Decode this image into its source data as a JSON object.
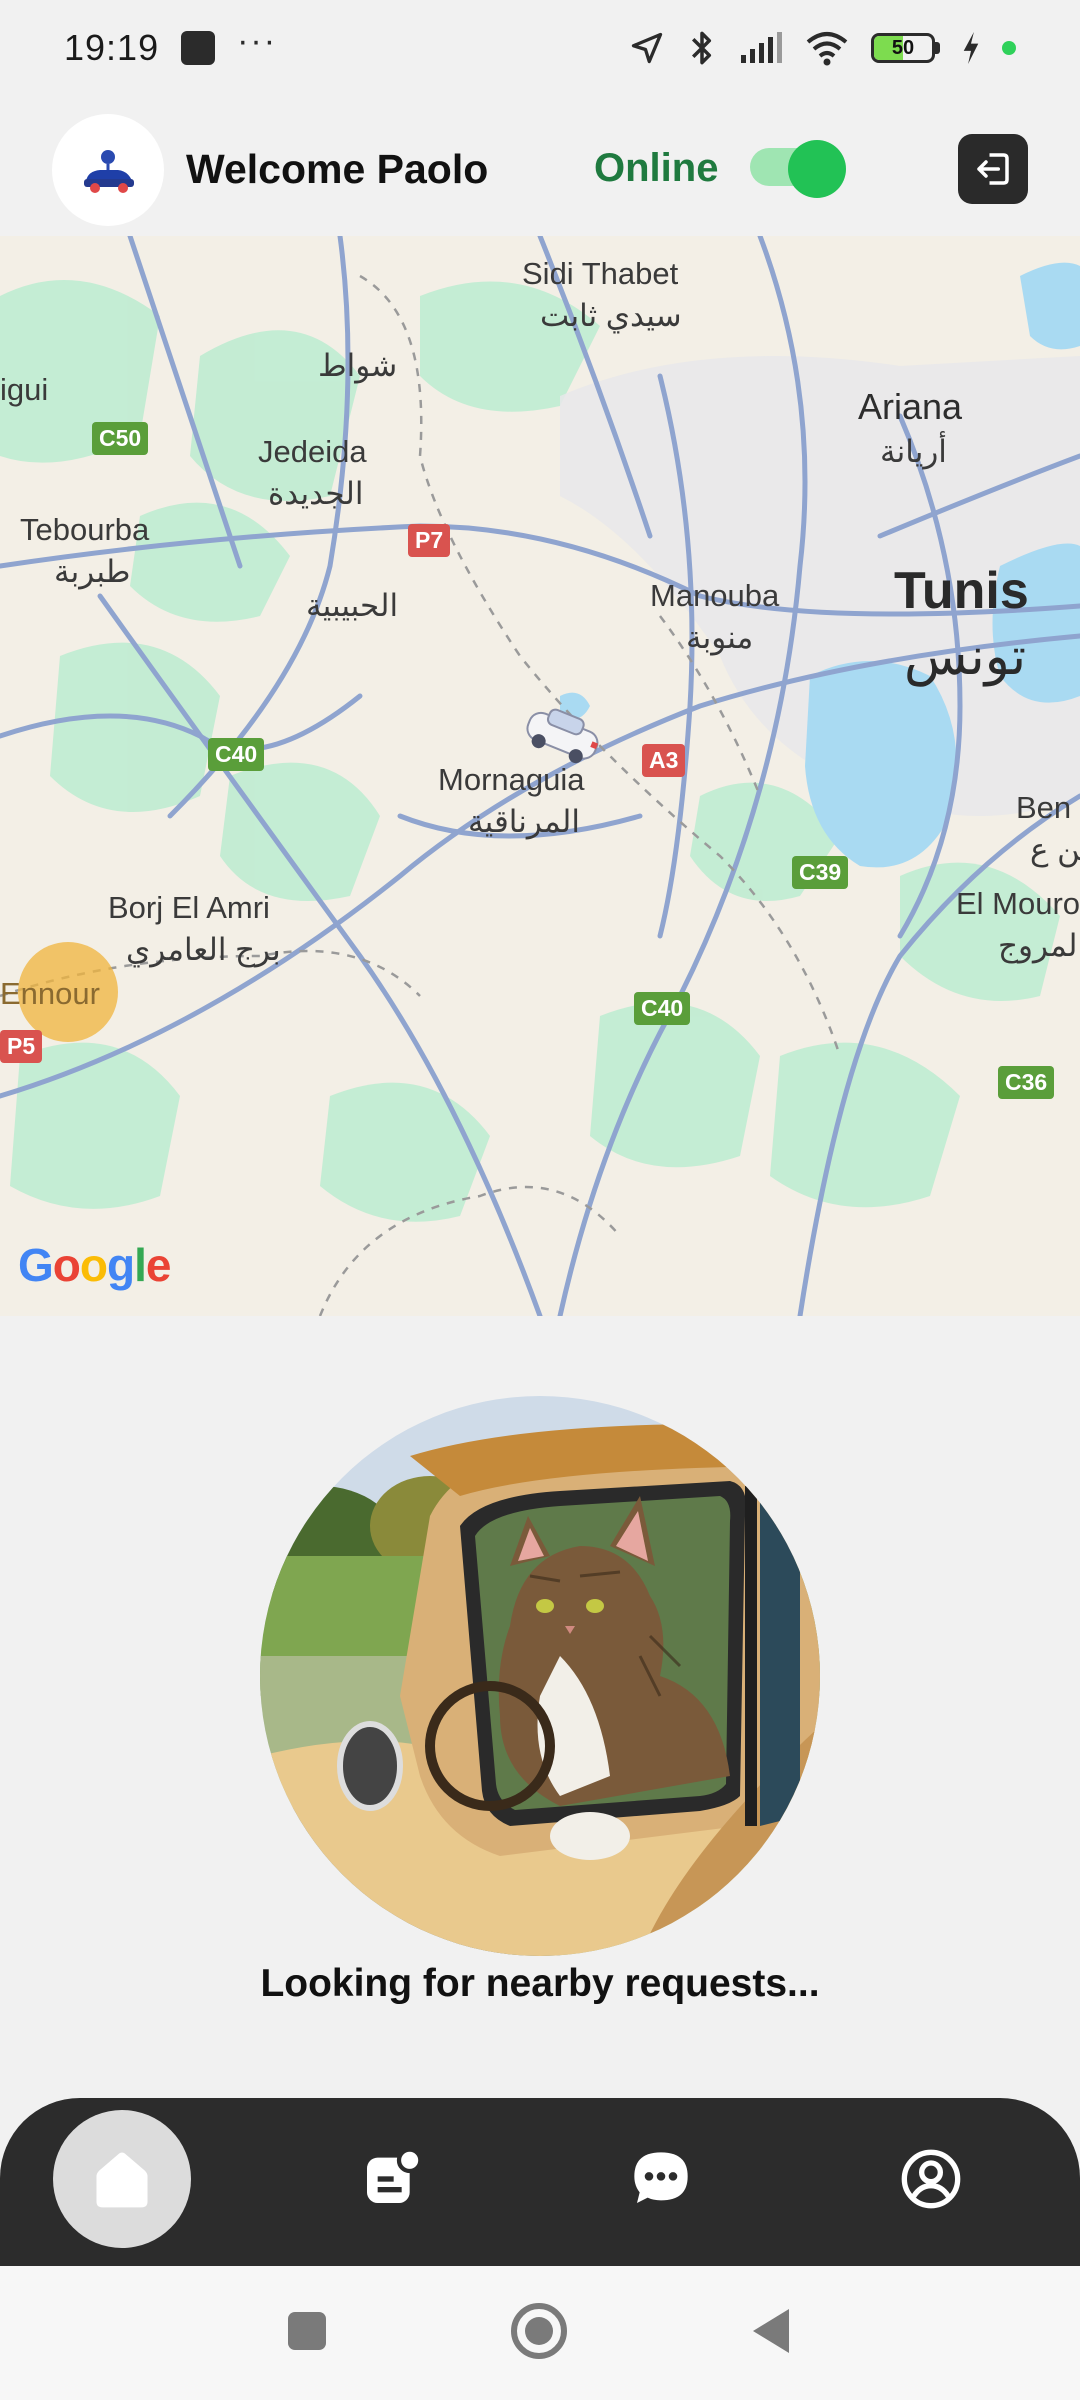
{
  "status_bar": {
    "time": "19:19",
    "dots": "···",
    "battery_level": "50",
    "battery_fraction": 0.5,
    "icons": [
      "location-arrow-icon",
      "bluetooth-icon",
      "signal-icon",
      "wifi-icon",
      "battery-icon",
      "charging-icon",
      "active-dot-icon"
    ]
  },
  "header": {
    "welcome_text": "Welcome Paolo",
    "status_label": "Online",
    "status_color": "#1f7a3f",
    "online_toggle": true,
    "avatar_icon": "car-logo-icon",
    "logout_icon": "logout-icon"
  },
  "map": {
    "labels": {
      "sidi_thabet": "Sidi Thabet",
      "sidi_thabet_ar": "سيدي ثابت",
      "shawat_ar": "شواط",
      "igui": "igui",
      "jedeida": "Jedeida",
      "jedeida_ar": "الجديدة",
      "tebourba": "Tebourba",
      "tebourba_ar": "طبربة",
      "habibia_ar": "الحبيبية",
      "ariana": "Ariana",
      "ariana_ar": "أريانة",
      "manouba": "Manouba",
      "manouba_ar": "منوبة",
      "tunis": "Tunis",
      "tunis_ar": "تونس",
      "mornaguia": "Mornaguia",
      "mornaguia_ar": "المرناقية",
      "ben": "Ben",
      "ben_ar": "بن ع",
      "borj_el_amri": "Borj El Amri",
      "borj_el_amri_ar": "برج العامري",
      "el_mourouj": "El Mourouj",
      "el_mourouj_ar": "المروج",
      "ennour": "Ennour"
    },
    "roads": {
      "c50": "C50",
      "p7": "P7",
      "c40_a": "C40",
      "a3": "A3",
      "c39": "C39",
      "c40_b": "C40",
      "c36": "C36",
      "p5": "P5"
    },
    "attribution": "Google"
  },
  "main": {
    "photo_description_icon": "cat-driving-car-photo",
    "status_text": "Looking for nearby requests..."
  },
  "bottom_nav": {
    "items": [
      {
        "name": "home",
        "icon": "home-icon",
        "active": true
      },
      {
        "name": "requests",
        "icon": "notes-icon",
        "active": false
      },
      {
        "name": "chat",
        "icon": "chat-icon",
        "active": false
      },
      {
        "name": "profile",
        "icon": "profile-icon",
        "active": false
      }
    ]
  },
  "system_nav": {
    "icons": [
      "recents-icon",
      "home-circle-icon",
      "back-icon"
    ]
  }
}
